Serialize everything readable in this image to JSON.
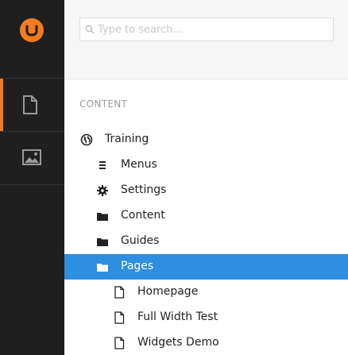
{
  "search": {
    "placeholder": "Type to search..."
  },
  "section_title": "CONTENT",
  "tree": [
    {
      "label": "Training",
      "icon": "globe-icon",
      "selected": false
    },
    {
      "label": "Menus",
      "icon": "list-icon",
      "selected": false
    },
    {
      "label": "Settings",
      "icon": "cog-icon",
      "selected": false
    },
    {
      "label": "Content",
      "icon": "folder-icon",
      "selected": false
    },
    {
      "label": "Guides",
      "icon": "folder-icon",
      "selected": false
    },
    {
      "label": "Pages",
      "icon": "folder-icon",
      "selected": true
    },
    {
      "label": "Homepage",
      "icon": "document-icon",
      "selected": false
    },
    {
      "label": "Full Width Test",
      "icon": "document-icon",
      "selected": false
    },
    {
      "label": "Widgets Demo",
      "icon": "document-icon",
      "selected": false
    }
  ],
  "colors": {
    "accent": "#f47b20",
    "selected": "#2e8ee0",
    "rail": "#1f1f1f"
  }
}
